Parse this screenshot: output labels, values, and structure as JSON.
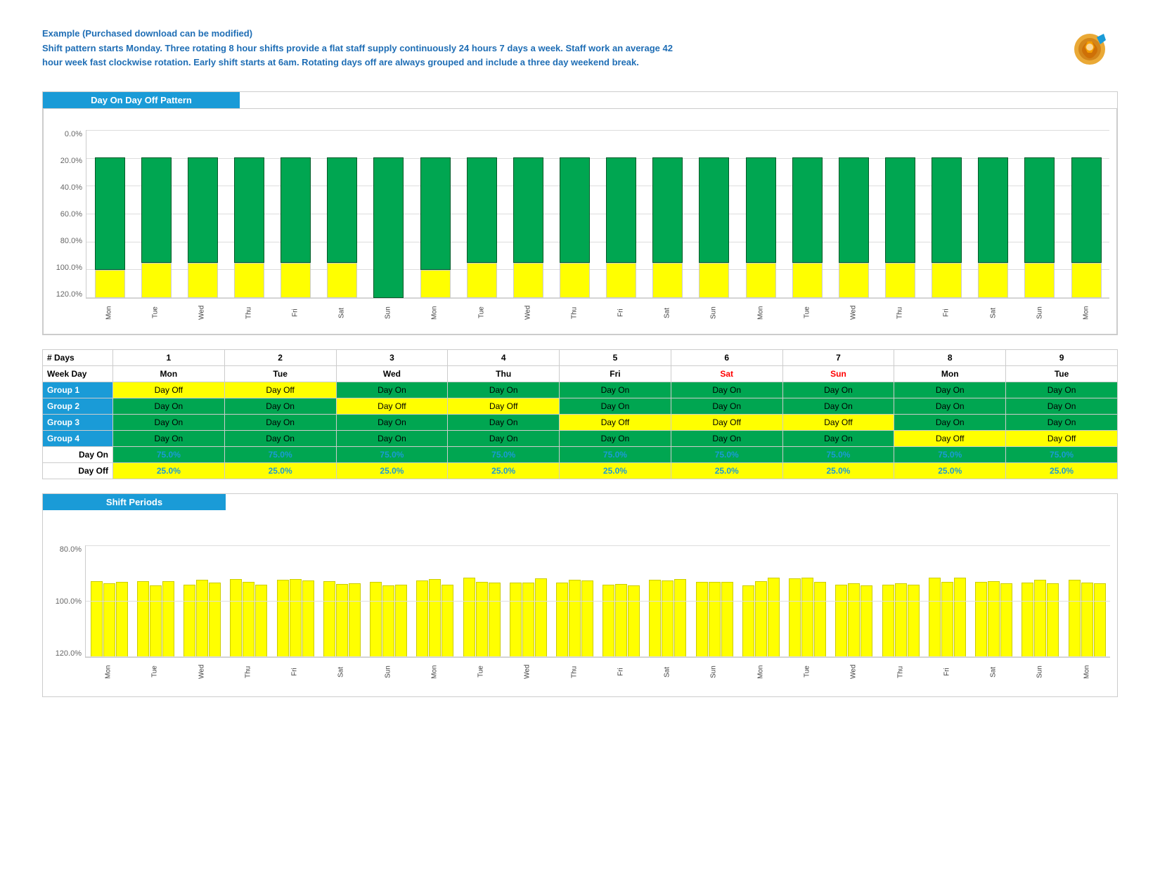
{
  "header": {
    "title": "Example (Purchased download can be modified)",
    "description": "Shift pattern starts Monday. Three rotating 8 hour  shifts provide a flat staff supply continuously 24 hours 7 days a week. Staff work an average 42 hour week fast clockwise rotation. Early shift starts at 6am. Rotating days off are always grouped  and include a three day weekend break."
  },
  "chart1": {
    "title": "Day On Day Off Pattern",
    "yAxis": [
      "0.0%",
      "20.0%",
      "40.0%",
      "60.0%",
      "80.0%",
      "100.0%",
      "120.0%"
    ],
    "bars": [
      {
        "label": "Mon",
        "green": 80,
        "yellow": 20
      },
      {
        "label": "Tue",
        "green": 75,
        "yellow": 25
      },
      {
        "label": "Wed",
        "green": 75,
        "yellow": 25
      },
      {
        "label": "Thu",
        "green": 75,
        "yellow": 25
      },
      {
        "label": "Fri",
        "green": 75,
        "yellow": 25
      },
      {
        "label": "Sat",
        "green": 75,
        "yellow": 25
      },
      {
        "label": "Sun",
        "green": 100,
        "yellow": 0
      },
      {
        "label": "Mon",
        "green": 80,
        "yellow": 20
      },
      {
        "label": "Tue",
        "green": 75,
        "yellow": 25
      },
      {
        "label": "Wed",
        "green": 75,
        "yellow": 25
      },
      {
        "label": "Thu",
        "green": 75,
        "yellow": 25
      },
      {
        "label": "Fri",
        "green": 75,
        "yellow": 25
      },
      {
        "label": "Sat",
        "green": 75,
        "yellow": 25
      },
      {
        "label": "Sun",
        "green": 75,
        "yellow": 25
      },
      {
        "label": "Mon",
        "green": 75,
        "yellow": 25
      },
      {
        "label": "Tue",
        "green": 75,
        "yellow": 25
      },
      {
        "label": "Wed",
        "green": 75,
        "yellow": 25
      },
      {
        "label": "Thu",
        "green": 75,
        "yellow": 25
      },
      {
        "label": "Fri",
        "green": 75,
        "yellow": 25
      },
      {
        "label": "Sat",
        "green": 75,
        "yellow": 25
      },
      {
        "label": "Sun",
        "green": 75,
        "yellow": 25
      },
      {
        "label": "Mon",
        "green": 75,
        "yellow": 25
      }
    ]
  },
  "table": {
    "days_header": "# Days",
    "weekday_header": "Week Day",
    "columns": [
      {
        "num": "1",
        "day": "Mon",
        "type": "weekday"
      },
      {
        "num": "2",
        "day": "Tue",
        "type": "weekday"
      },
      {
        "num": "3",
        "day": "Wed",
        "type": "weekday"
      },
      {
        "num": "4",
        "day": "Thu",
        "type": "weekday"
      },
      {
        "num": "5",
        "day": "Fri",
        "type": "weekday"
      },
      {
        "num": "6",
        "day": "Sat",
        "type": "weekend"
      },
      {
        "num": "7",
        "day": "Sun",
        "type": "weekend"
      },
      {
        "num": "8",
        "day": "Mon",
        "type": "weekday"
      },
      {
        "num": "9",
        "day": "Tue",
        "type": "weekday"
      }
    ],
    "groups": [
      {
        "name": "Group 1",
        "cells": [
          "Day Off",
          "Day Off",
          "Day On",
          "Day On",
          "Day On",
          "Day On",
          "Day On",
          "Day On",
          "Day On"
        ]
      },
      {
        "name": "Group 2",
        "cells": [
          "Day On",
          "Day On",
          "Day Off",
          "Day Off",
          "Day On",
          "Day On",
          "Day On",
          "Day On",
          "Day On"
        ]
      },
      {
        "name": "Group 3",
        "cells": [
          "Day On",
          "Day On",
          "Day On",
          "Day On",
          "Day Off",
          "Day Off",
          "Day Off",
          "Day On",
          "Day On"
        ]
      },
      {
        "name": "Group 4",
        "cells": [
          "Day On",
          "Day On",
          "Day On",
          "Day On",
          "Day On",
          "Day On",
          "Day On",
          "Day Off",
          "Day Off"
        ]
      }
    ],
    "day_on_row": {
      "label": "Day On",
      "values": [
        "75.0%",
        "75.0%",
        "75.0%",
        "75.0%",
        "75.0%",
        "75.0%",
        "75.0%",
        "75.0%",
        "75.0%"
      ]
    },
    "day_off_row": {
      "label": "Day Off",
      "values": [
        "25.0%",
        "25.0%",
        "25.0%",
        "25.0%",
        "25.0%",
        "25.0%",
        "25.0%",
        "25.0%",
        "25.0%"
      ]
    }
  },
  "chart2": {
    "title": "Shift Periods",
    "yAxis": [
      "80.0%",
      "100.0%",
      "120.0%"
    ],
    "bars_count": 22
  }
}
